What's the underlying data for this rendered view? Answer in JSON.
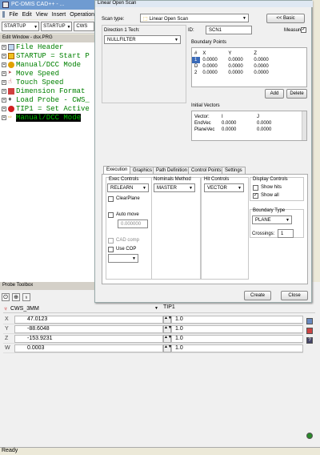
{
  "app": {
    "title": "PC-DMIS CAD++ - ..."
  },
  "menu": [
    "File",
    "Edit",
    "View",
    "Insert",
    "Operation"
  ],
  "toolbar": {
    "combos": [
      "STARTUP",
      "STARTUP",
      "CWS"
    ]
  },
  "edit_window": {
    "title": "Edit Window - dsx.PRG",
    "lines": [
      {
        "text": "File Header",
        "exp": "+"
      },
      {
        "text": "STARTUP = Start P",
        "exp": "+"
      },
      {
        "text": "Manual/DCC Mode",
        "exp": "+"
      },
      {
        "text": "Move Speed",
        "exp": "+"
      },
      {
        "text": "Touch Speed",
        "exp": "+"
      },
      {
        "text": "Dimension Format",
        "exp": "+"
      },
      {
        "text": "Load Probe - CWS_",
        "exp": "+"
      },
      {
        "text": "TIP1 = Set Active",
        "exp": "+"
      },
      {
        "text": "Manual/DCC Mode",
        "exp": "+"
      }
    ]
  },
  "probe_toolbox": {
    "title": "Probe Toolbox",
    "icons": [
      "⏻",
      "⊕",
      "♁"
    ],
    "probe": "CWS_3MM",
    "tip": "TIP1",
    "rows": [
      {
        "label": "X",
        "value": "47.0123",
        "value2": "1.0"
      },
      {
        "label": "Y",
        "value": "-88.6048",
        "value2": "1.0"
      },
      {
        "label": "Z",
        "value": "-153.9231",
        "value2": "1.0"
      },
      {
        "label": "W",
        "value": "0.0003",
        "value2": "1.0"
      }
    ]
  },
  "status": {
    "text": "Ready"
  },
  "dialog": {
    "title": "Linear Open Scan",
    "scan_type_label": "Scan type:",
    "scan_type_value": "Linear Open Scan",
    "basic_button": "<< Basic",
    "direction_label": "Direction 1 Tech:",
    "direction_value": "NULLFILTER",
    "id_label": "ID:",
    "id_value": "SCN1",
    "measure_label": "Measure",
    "measure_checked": "✓",
    "boundary_points": {
      "title": "Boundary Points",
      "headers": [
        "#",
        "X",
        "Y",
        "Z"
      ],
      "rows": [
        [
          "1",
          "0.0000",
          "0.0000",
          "0.0000"
        ],
        [
          "D",
          "0.0000",
          "0.0000",
          "0.0000"
        ],
        [
          "2",
          "0.0000",
          "0.0000",
          "0.0000"
        ]
      ],
      "add": "Add",
      "delete": "Delete"
    },
    "initial_vectors": {
      "title": "Initial Vectors",
      "headers": [
        "Vector:",
        "I",
        "J"
      ],
      "rows": [
        [
          "EndVec",
          "0.0000",
          "0.0000"
        ],
        [
          "PlaneVec",
          "0.0000",
          "0.0000"
        ]
      ]
    },
    "tabs": [
      "Execution",
      "Graphics",
      "Path Definition",
      "Control Points",
      "Settings"
    ],
    "exec": {
      "exec_controls_label": "Exec Controls",
      "exec_value": "RELEARN",
      "clear_plane": "ClearPlane",
      "auto_move": "Auto move",
      "auto_move_value": "0.000000",
      "cad_comp": "CAD comp",
      "use_cop": "Use COP",
      "nominals_label": "Nominals Method",
      "nominals_value": "MASTER",
      "hit_label": "Hit Controls",
      "hit_value": "VECTOR",
      "display_label": "Display Controls",
      "show_hits": "Show hits",
      "show_all": "Show all",
      "show_all_checked": "✓",
      "boundary_type_label": "Boundary Type",
      "boundary_type_value": "PLANE",
      "crossings_label": "Crossings:",
      "crossings_value": "1"
    },
    "create": "Create",
    "close": "Close"
  }
}
